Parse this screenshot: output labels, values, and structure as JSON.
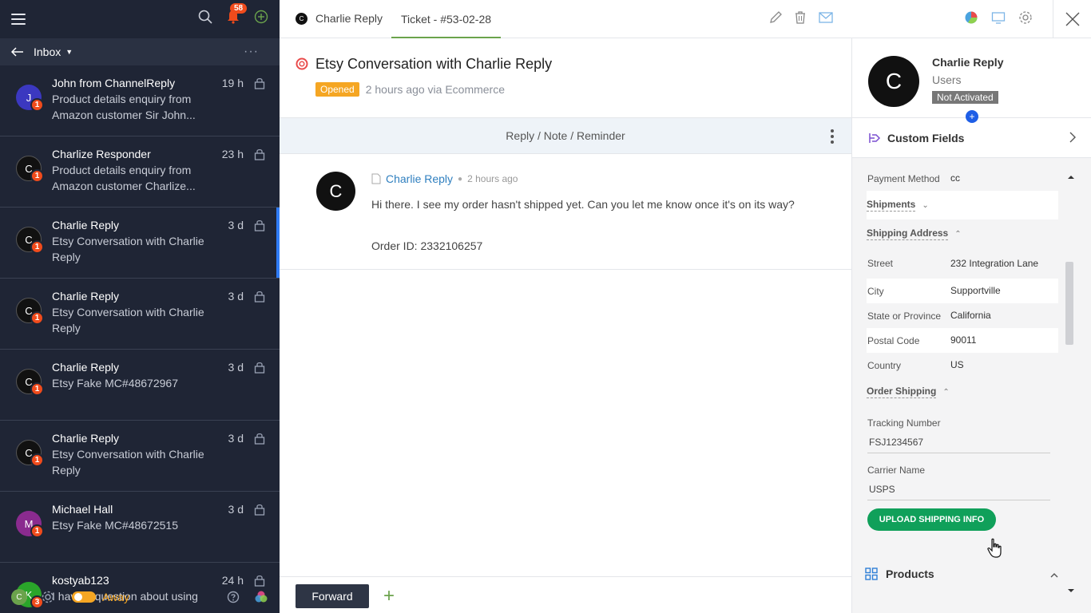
{
  "left": {
    "notification_count": "58",
    "inbox_label": "Inbox",
    "more": "···",
    "conversations": [
      {
        "initial": "J",
        "color": "#3b38c0",
        "name": "John from ChannelReply",
        "time": "19 h",
        "text": "Product details enquiry from Amazon customer Sir John...",
        "badge": "1"
      },
      {
        "initial": "C",
        "color": "#111111",
        "name": "Charlize Responder",
        "time": "23 h",
        "text": "Product details enquiry from Amazon customer Charlize...",
        "badge": "1"
      },
      {
        "initial": "C",
        "color": "#111111",
        "name": "Charlie Reply",
        "time": "3 d",
        "text": "Etsy Conversation with Charlie Reply",
        "badge": "1",
        "selected": true
      },
      {
        "initial": "C",
        "color": "#111111",
        "name": "Charlie Reply",
        "time": "3 d",
        "text": "Etsy Conversation with Charlie Reply",
        "badge": "1"
      },
      {
        "initial": "C",
        "color": "#111111",
        "name": "Charlie Reply",
        "time": "3 d",
        "text": "Etsy Fake MC#48672967",
        "badge": "1"
      },
      {
        "initial": "C",
        "color": "#111111",
        "name": "Charlie Reply",
        "time": "3 d",
        "text": "Etsy Conversation with Charlie Reply",
        "badge": "1"
      },
      {
        "initial": "M",
        "color": "#8a2b8f",
        "name": "Michael Hall",
        "time": "3 d",
        "text": "Etsy Fake MC#48672515",
        "badge": "1"
      },
      {
        "initial": "K",
        "color": "#2aa52a",
        "name": "kostyab123",
        "time": "24 h",
        "text": "I have a question about using",
        "badge": "3"
      }
    ],
    "user_initial": "C",
    "status_label": "Away"
  },
  "header": {
    "contact_initial": "C",
    "contact_tab": "Charlie Reply",
    "ticket_tab": "Ticket - #53-02-28"
  },
  "ticket": {
    "title": "Etsy Conversation with Charlie Reply",
    "status": "Opened",
    "meta": "2 hours ago via Ecommerce",
    "reply_bar": "Reply / Note / Reminder"
  },
  "message": {
    "initial": "C",
    "author": "Charlie Reply",
    "time": "2 hours ago",
    "body_1": "Hi there. I see my order hasn't shipped yet. Can you let me know once it's on its way?",
    "body_2": "Order ID: 2332106257"
  },
  "bottom": {
    "forward_label": "Forward",
    "add_label": "+"
  },
  "contact": {
    "initial": "C",
    "name": "Charlie Reply",
    "role": "Users",
    "status": "Not Activated"
  },
  "custom_fields": {
    "title": "Custom Fields",
    "payment_method_key": "Payment Method",
    "payment_method_val": "cc",
    "shipments_label": "Shipments",
    "shipping_address_label": "Shipping Address",
    "address": [
      {
        "key": "Street",
        "val": "232 Integration Lane"
      },
      {
        "key": "City",
        "val": "Supportville"
      },
      {
        "key": "State or Province",
        "val": "California"
      },
      {
        "key": "Postal Code",
        "val": "90011"
      },
      {
        "key": "Country",
        "val": "US"
      }
    ],
    "order_shipping_label": "Order Shipping",
    "tracking_label": "Tracking Number",
    "tracking_value": "FSJ1234567",
    "carrier_label": "Carrier Name",
    "carrier_value": "USPS",
    "upload_label": "UPLOAD SHIPPING INFO",
    "products_label": "Products"
  }
}
